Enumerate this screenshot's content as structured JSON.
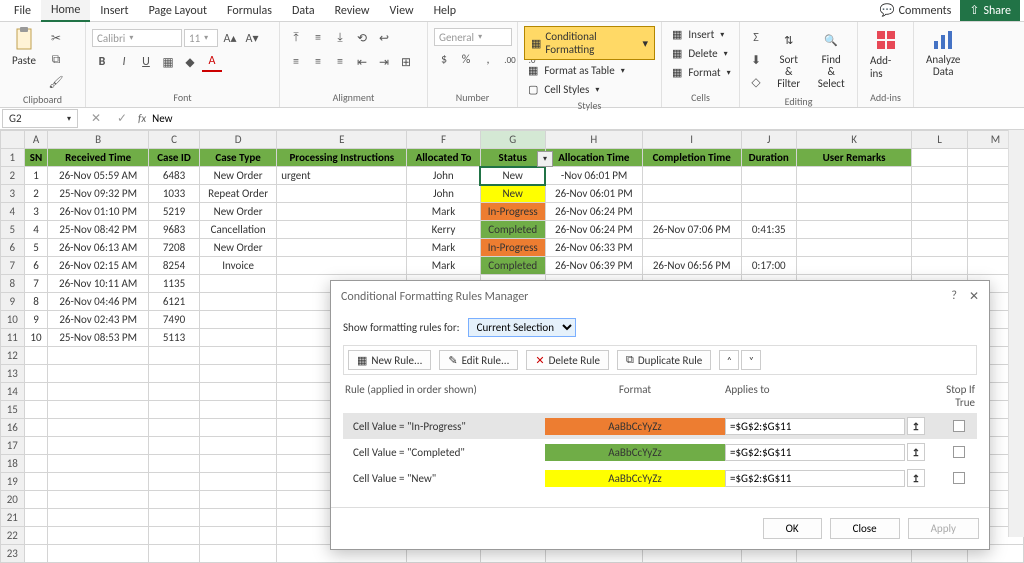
{
  "menu": {
    "tabs": [
      "File",
      "Home",
      "Insert",
      "Page Layout",
      "Formulas",
      "Data",
      "Review",
      "View",
      "Help"
    ],
    "active": 1,
    "comments": "Comments",
    "share": "Share"
  },
  "ribbon": {
    "clipboard": {
      "paste": "Paste",
      "label": "Clipboard"
    },
    "font": {
      "name": "Calibri",
      "size": "11",
      "label": "Font"
    },
    "alignment": {
      "label": "Alignment"
    },
    "number": {
      "format": "General",
      "label": "Number"
    },
    "styles": {
      "cf": "Conditional Formatting",
      "fat": "Format as Table",
      "cs": "Cell Styles",
      "label": "Styles"
    },
    "cells": {
      "insert": "Insert",
      "delete": "Delete",
      "format": "Format",
      "label": "Cells"
    },
    "editing": {
      "sortfilter": "Sort & Filter",
      "findselect": "Find & Select",
      "label": "Editing"
    },
    "addins": {
      "addins": "Add-ins",
      "label": "Add-ins"
    },
    "analyze": {
      "label": "Analyze Data"
    }
  },
  "namebox": {
    "ref": "G2",
    "formula": "New"
  },
  "columns": [
    "",
    "A",
    "B",
    "C",
    "D",
    "E",
    "F",
    "G",
    "H",
    "I",
    "J",
    "K",
    "L",
    "M"
  ],
  "headers": {
    "A": "SN",
    "B": "Received Time",
    "C": "Case ID",
    "D": "Case Type",
    "E": "Processing Instructions",
    "F": "Allocated To",
    "G": "Status",
    "H": "Allocation Time",
    "I": "Completion Time",
    "J": "Duration",
    "K": "User Remarks"
  },
  "rows": [
    {
      "n": 1,
      "A": "1",
      "B": "26-Nov 05:59 AM",
      "C": "6483",
      "D": "New Order",
      "E": "urgent",
      "F": "John",
      "G": "New",
      "H": "-Nov 06:01 PM",
      "I": "",
      "J": "",
      "K": ""
    },
    {
      "n": 2,
      "A": "2",
      "B": "25-Nov 09:32 PM",
      "C": "1033",
      "D": "Repeat Order",
      "E": "",
      "F": "John",
      "G": "New",
      "H": "26-Nov 06:01 PM",
      "I": "",
      "J": "",
      "K": ""
    },
    {
      "n": 3,
      "A": "3",
      "B": "26-Nov 01:10 PM",
      "C": "5219",
      "D": "New Order",
      "E": "",
      "F": "Mark",
      "G": "In-Progress",
      "H": "26-Nov 06:24 PM",
      "I": "",
      "J": "",
      "K": ""
    },
    {
      "n": 4,
      "A": "4",
      "B": "25-Nov 08:42 PM",
      "C": "9683",
      "D": "Cancellation",
      "E": "",
      "F": "Kerry",
      "G": "Completed",
      "H": "26-Nov 06:24 PM",
      "I": "26-Nov 07:06 PM",
      "J": "0:41:35",
      "K": ""
    },
    {
      "n": 5,
      "A": "5",
      "B": "26-Nov 06:13 AM",
      "C": "7208",
      "D": "New Order",
      "E": "",
      "F": "Mark",
      "G": "In-Progress",
      "H": "26-Nov 06:33 PM",
      "I": "",
      "J": "",
      "K": ""
    },
    {
      "n": 6,
      "A": "6",
      "B": "26-Nov 02:15 AM",
      "C": "8254",
      "D": "Invoice",
      "E": "",
      "F": "Mark",
      "G": "Completed",
      "H": "26-Nov 06:39 PM",
      "I": "26-Nov 06:56 PM",
      "J": "0:17:00",
      "K": ""
    },
    {
      "n": 7,
      "A": "7",
      "B": "26-Nov 10:11 AM",
      "C": "1135",
      "D": "",
      "E": "",
      "F": "",
      "G": "",
      "H": "",
      "I": "",
      "J": "",
      "K": ""
    },
    {
      "n": 8,
      "A": "8",
      "B": "26-Nov 04:46 PM",
      "C": "6121",
      "D": "",
      "E": "",
      "F": "",
      "G": "",
      "H": "",
      "I": "",
      "J": "",
      "K": ""
    },
    {
      "n": 9,
      "A": "9",
      "B": "26-Nov 02:43 PM",
      "C": "7490",
      "D": "",
      "E": "",
      "F": "",
      "G": "",
      "H": "",
      "I": "",
      "J": "",
      "K": ""
    },
    {
      "n": 10,
      "A": "10",
      "B": "25-Nov 08:53 PM",
      "C": "5113",
      "D": "",
      "E": "",
      "F": "",
      "G": "",
      "H": "",
      "I": "",
      "J": "",
      "K": ""
    }
  ],
  "emptyRows": [
    12,
    13,
    14,
    15,
    16,
    17,
    18,
    19,
    20,
    21,
    22,
    23
  ],
  "colWidths": {
    "rownum": 24,
    "A": 24,
    "B": 102,
    "C": 52,
    "D": 78,
    "E": 132,
    "F": 74,
    "G": 66,
    "H": 98,
    "I": 100,
    "J": 56,
    "K": 120,
    "L": 60,
    "M": 60
  },
  "dialog": {
    "title": "Conditional Formatting Rules Manager",
    "showFor": "Show formatting rules for:",
    "scope": "Current Selection",
    "toolbar": {
      "new": "New Rule...",
      "edit": "Edit Rule...",
      "delete": "Delete Rule",
      "duplicate": "Duplicate Rule"
    },
    "hdr": {
      "c1": "Rule (applied in order shown)",
      "c2": "Format",
      "c3": "Applies to",
      "c4": "Stop If True"
    },
    "sample": "AaBbCcYyZz",
    "rules": [
      {
        "desc": "Cell Value = \"In-Progress\"",
        "fmt": "orange",
        "range": "=$G$2:$G$11",
        "sel": true
      },
      {
        "desc": "Cell Value = \"Completed\"",
        "fmt": "green",
        "range": "=$G$2:$G$11",
        "sel": false
      },
      {
        "desc": "Cell Value = \"New\"",
        "fmt": "yellow",
        "range": "=$G$2:$G$11",
        "sel": false
      }
    ],
    "btns": {
      "ok": "OK",
      "close": "Close",
      "apply": "Apply"
    }
  }
}
